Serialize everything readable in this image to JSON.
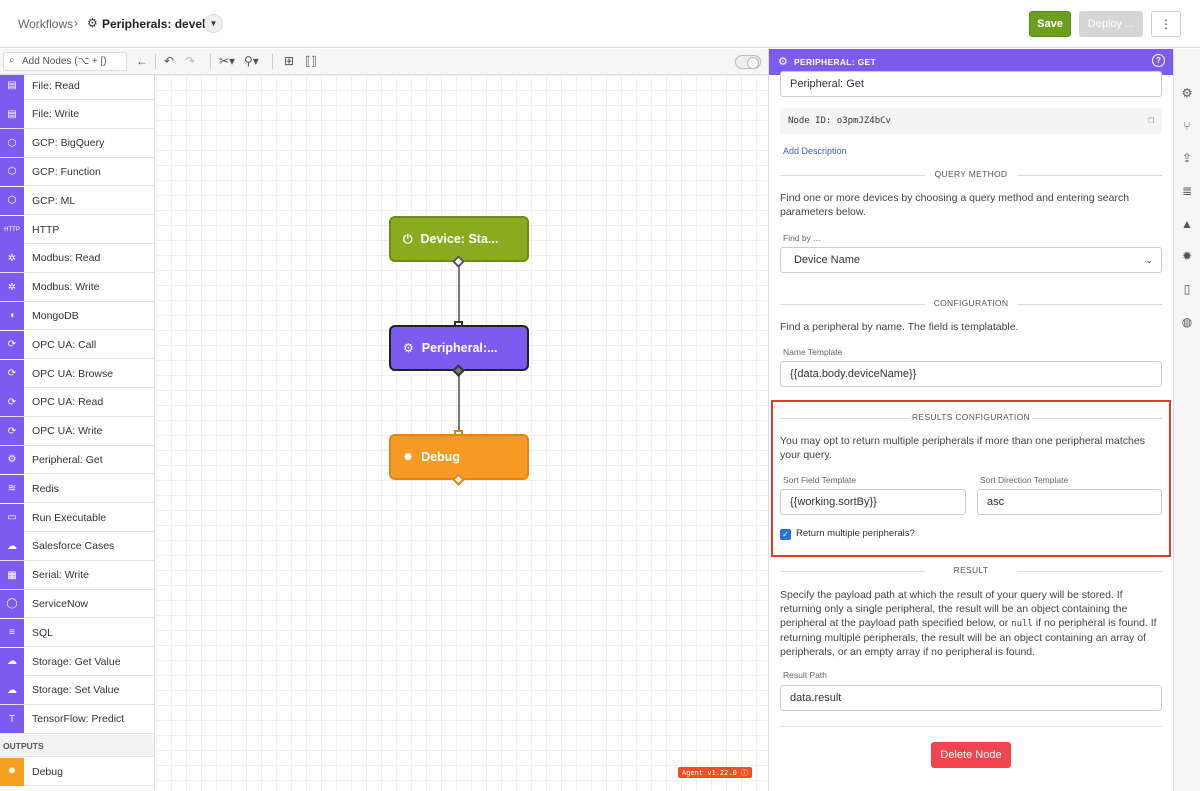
{
  "header": {
    "breadcrumb_root": "Workflows",
    "breadcrumb_sep": "›",
    "breadcrumb_current": "Peripherals: develop",
    "save_label": "Save",
    "deploy_label": "Deploy ...",
    "more_label": "⋮"
  },
  "toolbar": {
    "search_placeholder": "Add Nodes (⌥ + [)"
  },
  "palette": {
    "items": [
      {
        "label": "File: Read",
        "glyph": "▤"
      },
      {
        "label": "File: Write",
        "glyph": "▤"
      },
      {
        "label": "GCP: BigQuery",
        "glyph": "⬡"
      },
      {
        "label": "GCP: Function",
        "glyph": "⬡"
      },
      {
        "label": "GCP: ML",
        "glyph": "⬡"
      },
      {
        "label": "HTTP",
        "glyph": "HTTP"
      },
      {
        "label": "Modbus: Read",
        "glyph": "✲"
      },
      {
        "label": "Modbus: Write",
        "glyph": "✲"
      },
      {
        "label": "MongoDB",
        "glyph": "◖"
      },
      {
        "label": "OPC UA: Call",
        "glyph": "⟳"
      },
      {
        "label": "OPC UA: Browse",
        "glyph": "⟳"
      },
      {
        "label": "OPC UA: Read",
        "glyph": "⟳"
      },
      {
        "label": "OPC UA: Write",
        "glyph": "⟳"
      },
      {
        "label": "Peripheral: Get",
        "glyph": "⚙"
      },
      {
        "label": "Redis",
        "glyph": "≋"
      },
      {
        "label": "Run Executable",
        "glyph": "▭"
      },
      {
        "label": "Salesforce Cases",
        "glyph": "☁"
      },
      {
        "label": "Serial: Write",
        "glyph": "▦"
      },
      {
        "label": "ServiceNow",
        "glyph": "◯"
      },
      {
        "label": "SQL",
        "glyph": "≡"
      },
      {
        "label": "Storage: Get Value",
        "glyph": "☁"
      },
      {
        "label": "Storage: Set Value",
        "glyph": "☁"
      },
      {
        "label": "TensorFlow: Predict",
        "glyph": "T"
      }
    ],
    "outputs_section": "OUTPUTS",
    "outputs": [
      {
        "label": "Debug",
        "glyph": "✹"
      }
    ]
  },
  "canvas": {
    "nodes": {
      "device": {
        "label": "Device: Sta...",
        "glyph": "⏻"
      },
      "peripheral": {
        "label": "Peripheral:...",
        "glyph": "⚙"
      },
      "debug": {
        "label": "Debug",
        "glyph": "✹"
      }
    },
    "agent_badge": "Agent v1.22.0 ⓘ"
  },
  "panel": {
    "title": "PERIPHERAL: GET",
    "node_name": "Peripheral: Get",
    "node_id_label": "Node ID:",
    "node_id": "o3pmJZ4bCv",
    "add_description": "Add Description",
    "query_method": {
      "title": "QUERY METHOD",
      "description": "Find one or more devices by choosing a query method and entering search parameters below.",
      "find_by_label": "Find by ...",
      "find_by_value": "Device Name"
    },
    "configuration": {
      "title": "CONFIGURATION",
      "description": "Find a peripheral by name. The field is templatable.",
      "name_template_label": "Name Template",
      "name_template_value": "{{data.body.deviceName}}"
    },
    "results_configuration": {
      "title": "RESULTS CONFIGURATION",
      "description": "You may opt to return multiple peripherals if more than one peripheral matches your query.",
      "sort_field_label": "Sort Field Template",
      "sort_field_value": "{{working.sortBy}}",
      "sort_direction_label": "Sort Direction Template",
      "sort_direction_value": "asc",
      "return_multiple_label": "Return multiple peripherals?",
      "return_multiple_checked": true
    },
    "result": {
      "title": "RESULT",
      "desc_part1": "Specify the payload path at which the result of your query will be stored. If returning only a single peripheral, the result will be an object containing the peripheral at the payload path specified below, or",
      "desc_code": "null",
      "desc_part2": "if no peripheral is found. If returning multiple peripherals, the result will be an object containing an array of peripherals, or an empty array if no peripheral is found.",
      "result_path_label": "Result Path",
      "result_path_value": "data.result"
    },
    "delete_label": "Delete Node"
  },
  "rail": {
    "icons": [
      "gear-icon",
      "branch-icon",
      "upload-icon",
      "database-icon",
      "chart-icon",
      "bug-icon",
      "device-icon",
      "globe-icon"
    ]
  },
  "colors": {
    "accent_purple": "#7c5cf0",
    "save_green": "#6c9f1e",
    "debug_orange": "#f79a24",
    "delete_red": "#f0454f",
    "highlight_red": "#e03c2a"
  }
}
